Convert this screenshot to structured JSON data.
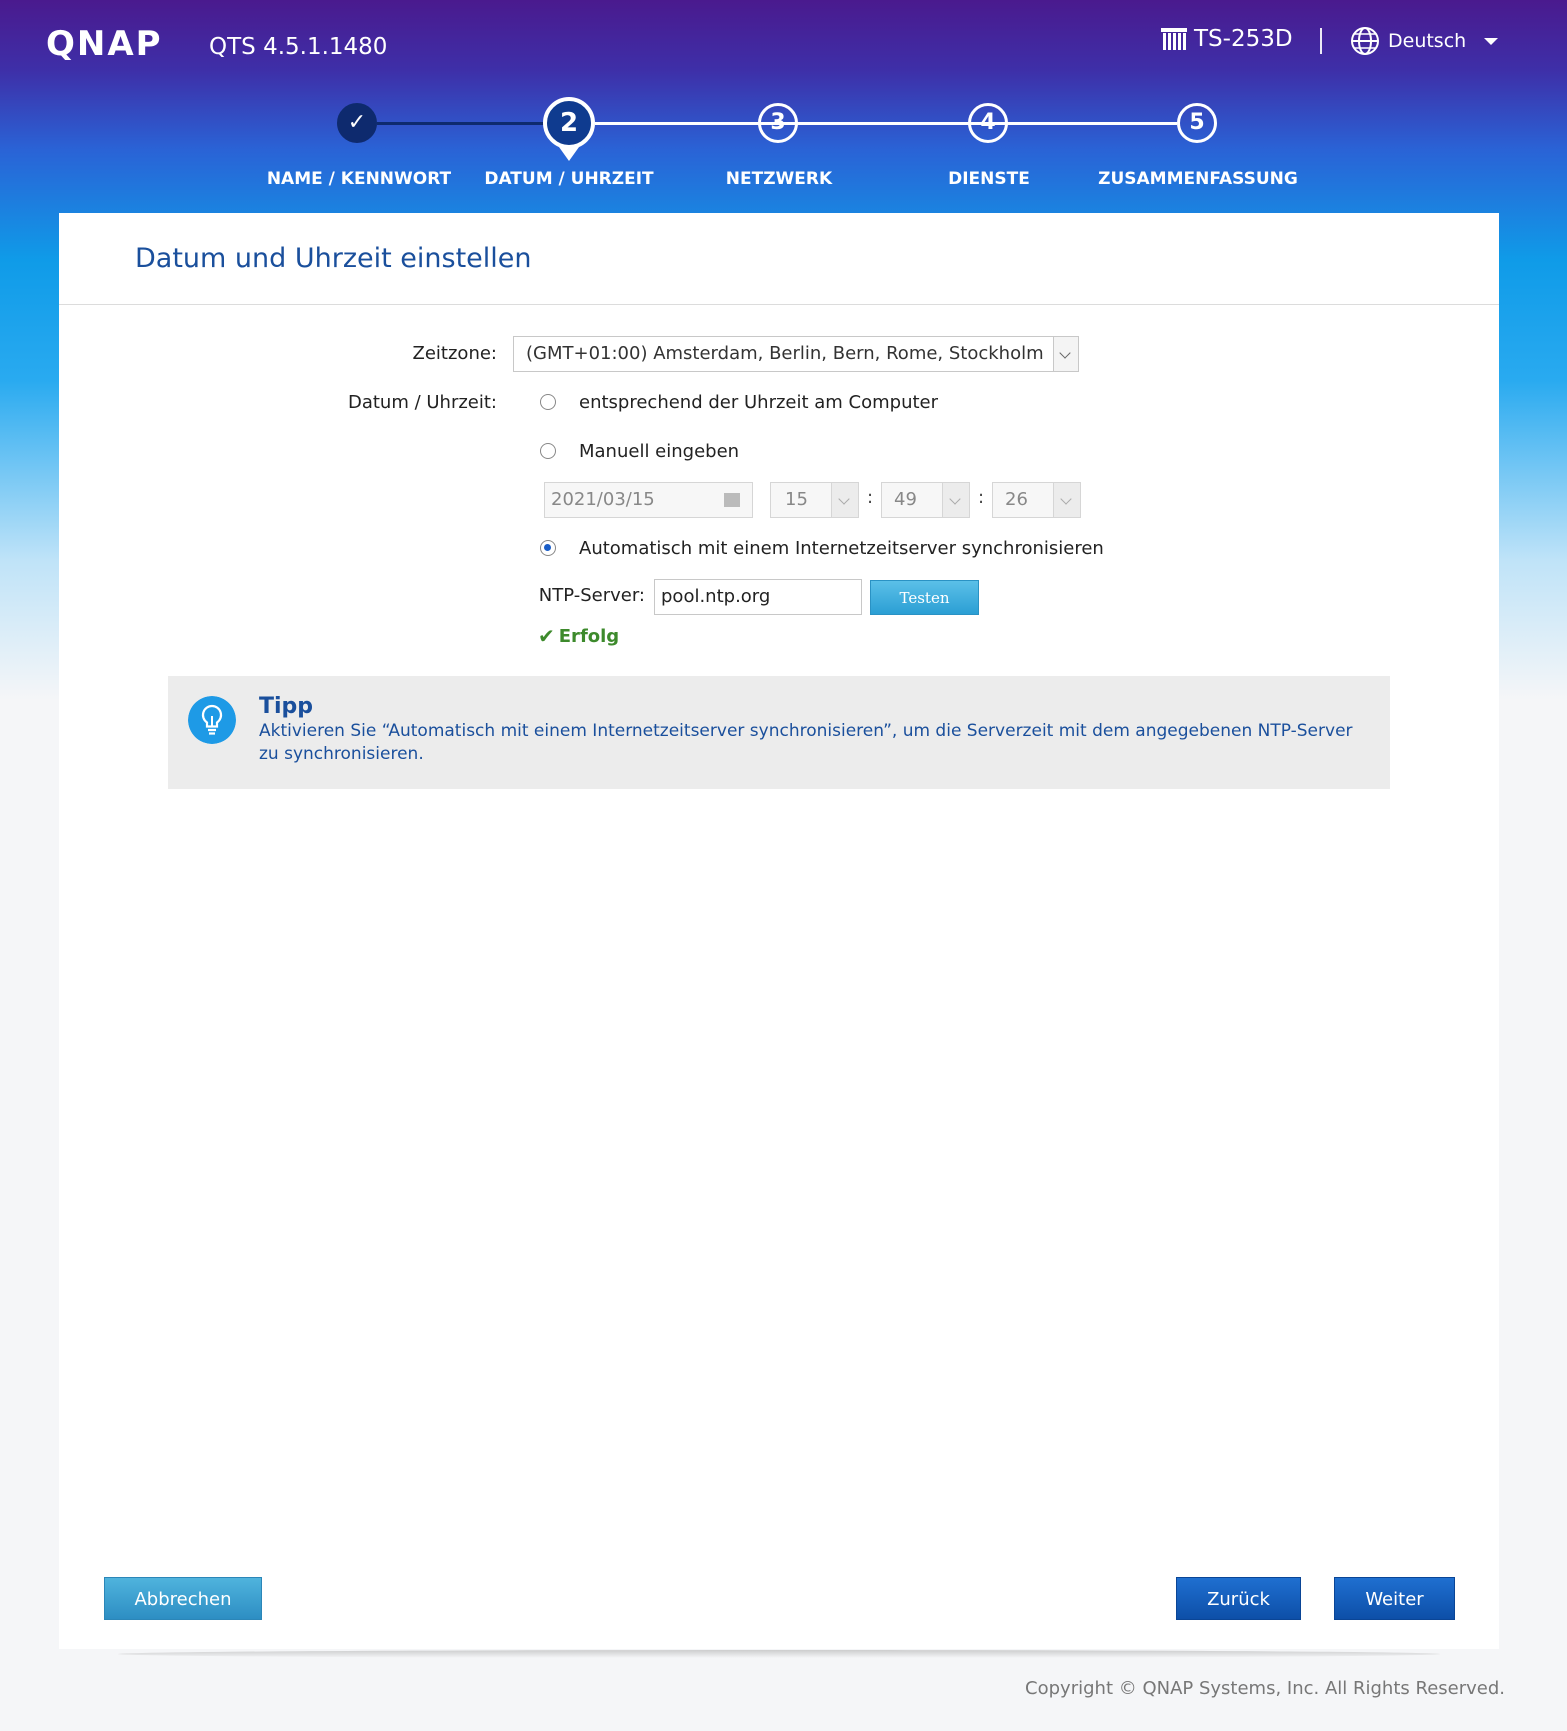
{
  "header": {
    "logo": "QNAP",
    "version": "QTS 4.5.1.1480",
    "device": "TS-253D",
    "language": "Deutsch"
  },
  "steps": [
    {
      "number": "✓",
      "label": "NAME / KENNWORT",
      "state": "done"
    },
    {
      "number": "2",
      "label": "DATUM / UHRZEIT",
      "state": "active"
    },
    {
      "number": "3",
      "label": "NETZWERK",
      "state": "todo"
    },
    {
      "number": "4",
      "label": "DIENSTE",
      "state": "todo"
    },
    {
      "number": "5",
      "label": "ZUSAMMENFASSUNG",
      "state": "todo"
    }
  ],
  "panel": {
    "title": "Datum und Uhrzeit einstellen",
    "timezone_label": "Zeitzone:",
    "timezone_value": "(GMT+01:00) Amsterdam, Berlin, Bern, Rome, Stockholm",
    "datetime_label": "Datum / Uhrzeit:",
    "option_computer": "entsprechend der Uhrzeit am Computer",
    "option_manual": "Manuell eingeben",
    "option_auto": "Automatisch mit einem Internetzeitserver synchronisieren",
    "selected_option": "auto",
    "date_value": "2021/03/15",
    "hour_value": "15",
    "minute_value": "49",
    "second_value": "26",
    "time_separator": ":",
    "ntp_label": "NTP-Server:",
    "ntp_value": "pool.ntp.org",
    "test_button": "Testen",
    "success_text": "Erfolg"
  },
  "tip": {
    "title": "Tipp",
    "text": "Aktivieren Sie “Automatisch mit einem Internetzeitserver synchronisieren”, um die Serverzeit mit dem angegebenen NTP-Server zu synchronisieren."
  },
  "buttons": {
    "cancel": "Abbrechen",
    "back": "Zurück",
    "next": "Weiter"
  },
  "footer": {
    "copyright": "Copyright © QNAP Systems, Inc. All Rights Reserved."
  },
  "colors": {
    "primary_blue": "#0d4fa8",
    "title_blue": "#1a4f9c",
    "success_green": "#3d8a2c"
  }
}
